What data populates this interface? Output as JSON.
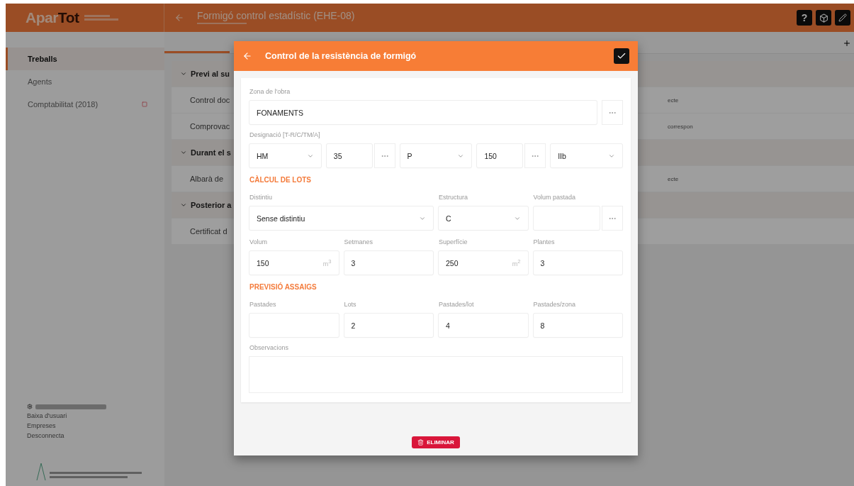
{
  "logo": {
    "light": "Apar",
    "dark": "Tot"
  },
  "header": {
    "title": "Formigó control estadístic (EHE-08)",
    "actions": [
      {
        "kind": "help",
        "label": "?"
      },
      {
        "kind": "cube"
      },
      {
        "kind": "edit"
      }
    ]
  },
  "sidebar": {
    "items": [
      {
        "label": "Treballs",
        "selected": true,
        "flag": false
      },
      {
        "label": "Agents",
        "selected": false,
        "flag": false
      },
      {
        "label": "Comptabilitat (2018)",
        "selected": false,
        "flag": true
      }
    ],
    "user_menu": [
      "Baixa d'usuari",
      "Empreses",
      "Desconnecta"
    ]
  },
  "background": {
    "sections": [
      {
        "title": "Previ al su",
        "rows": [
          {
            "label": "Control doc",
            "note": "ecte"
          },
          {
            "label": "Comprovac",
            "note": "correspon"
          }
        ]
      },
      {
        "title": "Durant el s",
        "rows": [
          {
            "label": "Albarà de",
            "note": "ecte"
          }
        ]
      },
      {
        "title": "Posterior a",
        "rows": [
          {
            "label": "Certificat d"
          }
        ]
      }
    ]
  },
  "dialog": {
    "title": "Control de la resistència de formigó",
    "zone": {
      "label": "Zona de l'obra",
      "value": "FONAMENTS"
    },
    "designation": {
      "label": "Designació [T-R/C/TM/A]",
      "parts": [
        {
          "kind": "select",
          "value": "HM"
        },
        {
          "kind": "dots",
          "value": "35"
        },
        {
          "kind": "select",
          "value": "P"
        },
        {
          "kind": "dots",
          "value": "150"
        },
        {
          "kind": "select",
          "value": "IIb"
        }
      ]
    },
    "sections": [
      {
        "title": "CÀLCUL DE LOTS",
        "fields": [
          {
            "label": "Distintiu",
            "kind": "wide_select",
            "value": "Sense distintiu"
          },
          {
            "label": "Estructura",
            "kind": "select",
            "value": "C"
          },
          {
            "label": "Volum pastada",
            "kind": "dots"
          },
          {
            "label": "Volum",
            "kind": "unit",
            "value": "150",
            "unit": "m$^{3}$"
          },
          {
            "label": "Setmanes",
            "kind": "input",
            "value": "3"
          },
          {
            "label": "Superfície",
            "kind": "unit",
            "value": "250",
            "unit": "m$^{2}$"
          },
          {
            "label": "Plantes",
            "kind": "input",
            "value": "3"
          }
        ]
      },
      {
        "title": "PREVISIÓ ASSAIGS",
        "fields": [
          {
            "label": "Pastades",
            "kind": "input"
          },
          {
            "label": "Lots",
            "kind": "input",
            "value": "2"
          },
          {
            "label": "Pastades/lot",
            "kind": "input",
            "value": "4"
          },
          {
            "label": "Pastades/zona",
            "kind": "input",
            "value": "8"
          }
        ]
      }
    ],
    "notes": {
      "label": "Observacions"
    },
    "delete_button": "ELIMINAR"
  }
}
